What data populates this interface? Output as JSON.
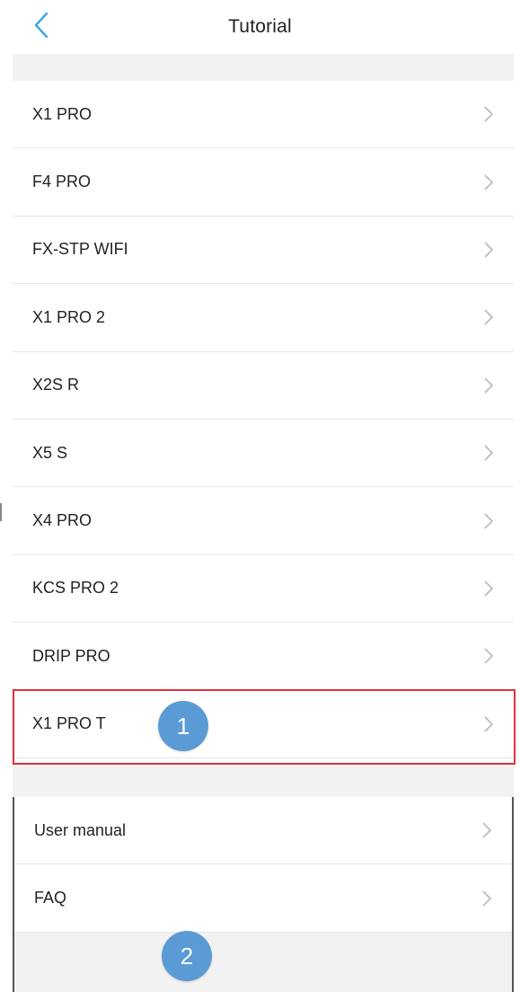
{
  "header": {
    "title": "Tutorial",
    "back_icon": "chevron-left-icon",
    "back_icon_color": "#3aa8e0"
  },
  "products": [
    {
      "label": "X1 PRO"
    },
    {
      "label": "F4 PRO"
    },
    {
      "label": "FX-STP WIFI"
    },
    {
      "label": "X1 PRO 2"
    },
    {
      "label": "X2S R"
    },
    {
      "label": "X5 S"
    },
    {
      "label": "X4 PRO"
    },
    {
      "label": "KCS PRO 2"
    },
    {
      "label": "DRIP PRO"
    },
    {
      "label": "X1 PRO T"
    }
  ],
  "resources": [
    {
      "label": "User manual"
    },
    {
      "label": "FAQ"
    }
  ],
  "annotations": {
    "callout_1": "1",
    "callout_2": "2",
    "highlight_color": "#e2303a",
    "callout_color": "#5b9bd5"
  }
}
